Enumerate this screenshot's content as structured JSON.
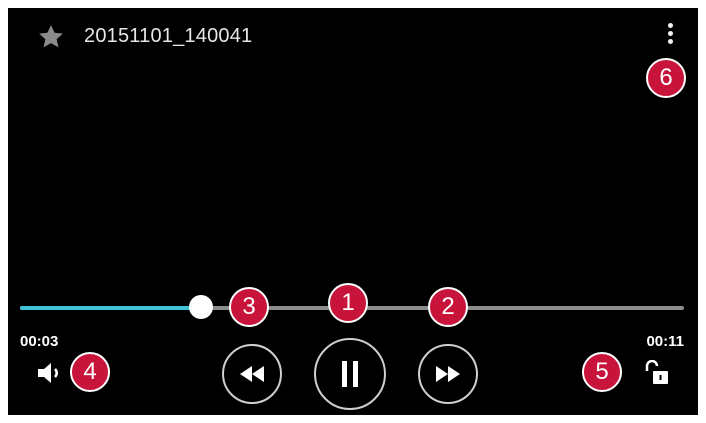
{
  "header": {
    "title": "20151101_140041",
    "favorite_icon": "star-icon",
    "menu_icon": "more-vert-icon"
  },
  "playback": {
    "current_time": "00:03",
    "duration": "00:11",
    "progress_fraction": 0.273
  },
  "controls": {
    "rewind_icon": "rewind-icon",
    "pause_icon": "pause-icon",
    "fast_forward_icon": "fast-forward-icon",
    "volume_icon": "volume-icon",
    "lock_icon": "unlock-icon"
  },
  "callouts": [
    "1",
    "2",
    "3",
    "4",
    "5",
    "6"
  ],
  "colors": {
    "progress": "#3ec3d6",
    "track": "#8c8c8c",
    "callout": "#c8143a",
    "background": "#000000"
  }
}
